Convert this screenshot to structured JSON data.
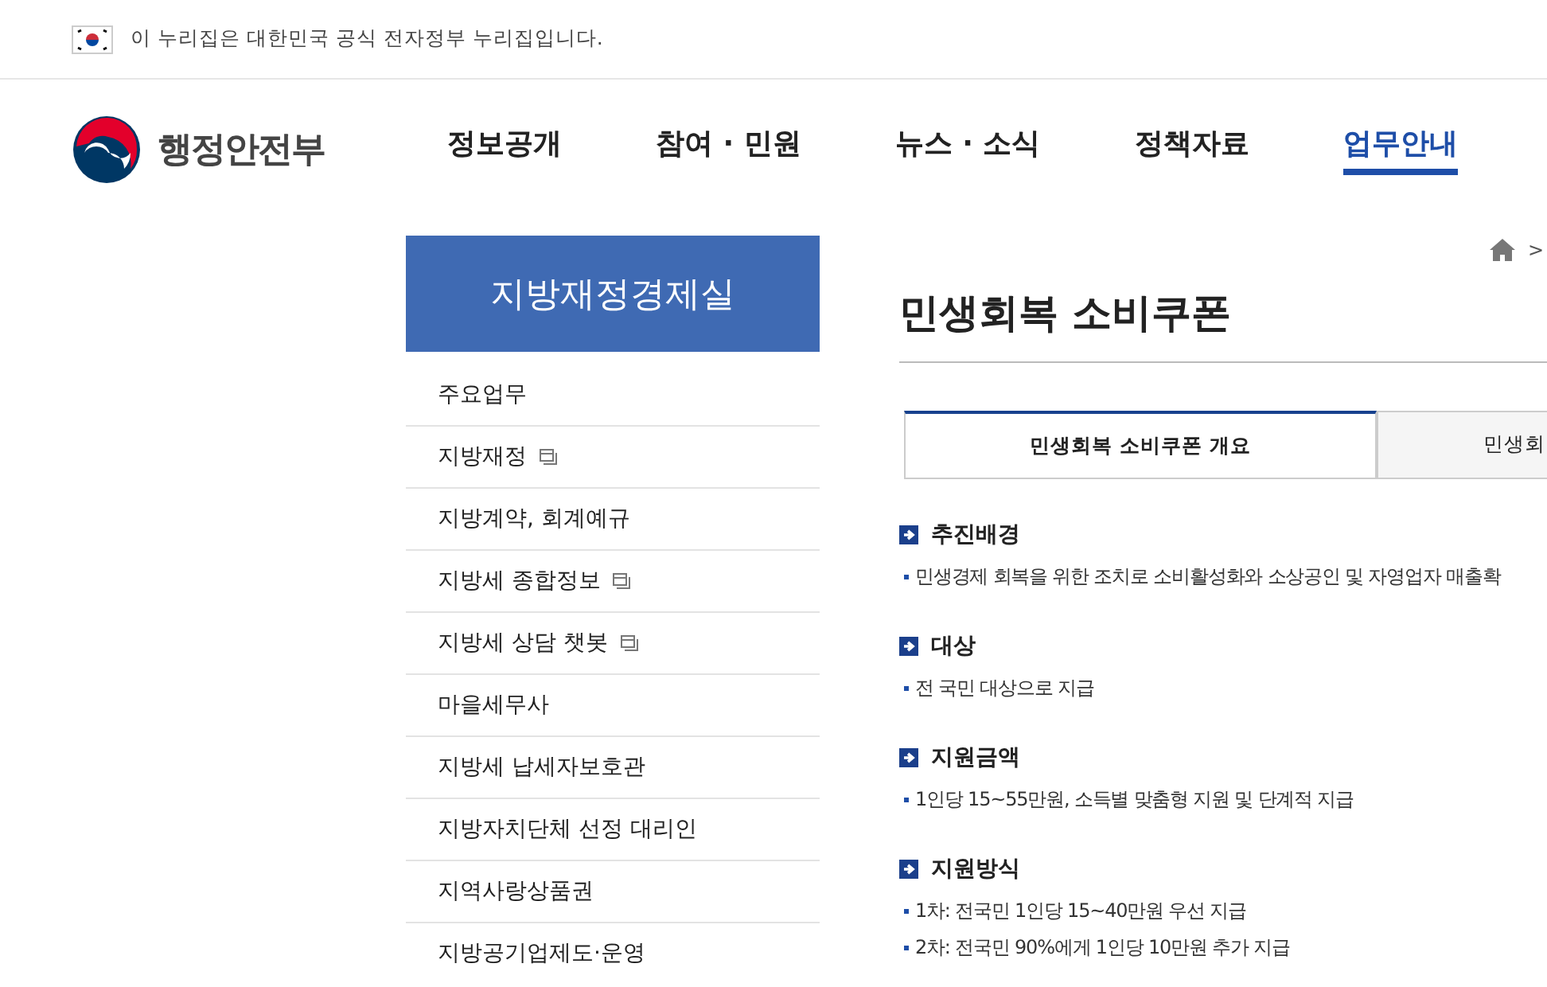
{
  "gov_banner": {
    "text": "이 누리집은 대한민국 공식 전자정부 누리집입니다."
  },
  "header": {
    "logo_text": "행정안전부",
    "nav": [
      {
        "label": "정보공개",
        "selected": false
      },
      {
        "label": "참여 · 민원",
        "selected": false
      },
      {
        "label": "뉴스 · 소식",
        "selected": false
      },
      {
        "label": "정책자료",
        "selected": false
      },
      {
        "label": "업무안내",
        "selected": true
      }
    ]
  },
  "sidebar": {
    "title": "지방재정경제실",
    "items": [
      {
        "label": "주요업무",
        "new_window": false
      },
      {
        "label": "지방재정",
        "new_window": true
      },
      {
        "label": "지방계약, 회계예규",
        "new_window": false
      },
      {
        "label": "지방세 종합정보",
        "new_window": true
      },
      {
        "label": "지방세 상담 챗봇",
        "new_window": true
      },
      {
        "label": "마을세무사",
        "new_window": false
      },
      {
        "label": "지방세 납세자보호관",
        "new_window": false
      },
      {
        "label": "지방자치단체 선정 대리인",
        "new_window": false
      },
      {
        "label": "지역사랑상품권",
        "new_window": false
      },
      {
        "label": "지방공기업제도·운영",
        "new_window": false
      }
    ]
  },
  "breadcrumb": {
    "separator": ">"
  },
  "page_title": "민생회복 소비쿠폰",
  "tabs": [
    {
      "label": "민생회복 소비쿠폰 개요",
      "selected": true
    },
    {
      "label": "민생회",
      "selected": false
    }
  ],
  "sections": [
    {
      "heading": "추진배경",
      "bullets": [
        "민생경제 회복을 위한 조치로 소비활성화와 소상공인 및 자영업자 매출확"
      ]
    },
    {
      "heading": "대상",
      "bullets": [
        "전 국민 대상으로 지급"
      ]
    },
    {
      "heading": "지원금액",
      "bullets": [
        "1인당 15~55만원, 소득별 맞춤형 지원 및 단계적 지급"
      ]
    },
    {
      "heading": "지원방식",
      "bullets": [
        "1차: 전국민 1인당 15~40만원 우선 지급",
        "2차: 전국민 90%에게 1인당 10만원 추가 지급"
      ]
    }
  ]
}
